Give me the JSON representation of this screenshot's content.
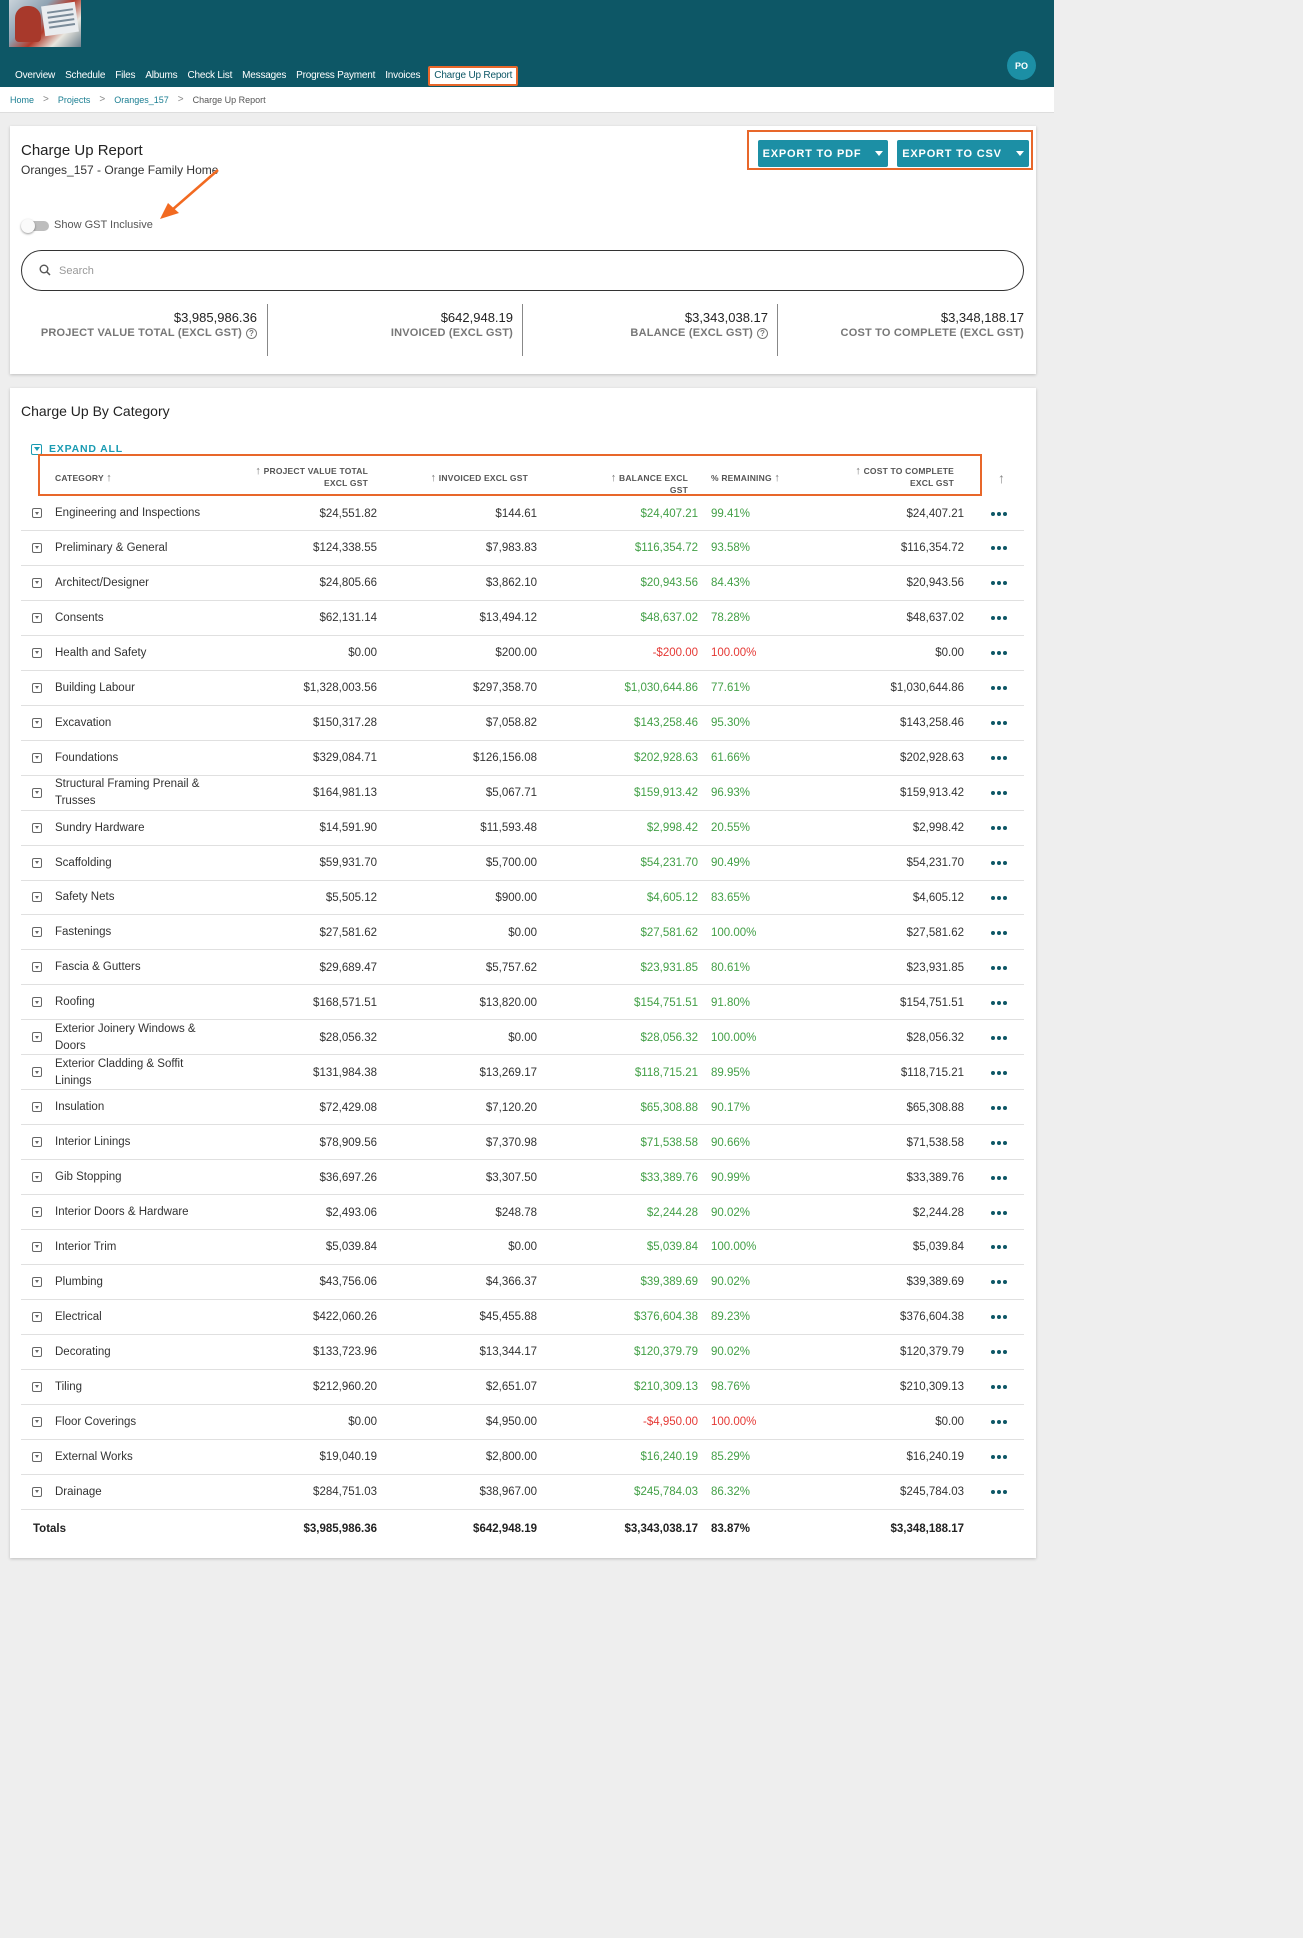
{
  "nav": {
    "items": [
      "Overview",
      "Schedule",
      "Files",
      "Albums",
      "Check List",
      "Messages",
      "Progress Payment",
      "Invoices",
      "Charge Up Report"
    ],
    "active": "Charge Up Report",
    "avatar_initials": "PO"
  },
  "breadcrumb": {
    "home": "Home",
    "projects": "Projects",
    "project": "Oranges_157",
    "current": "Charge Up Report",
    "separator": ">"
  },
  "report": {
    "title": "Charge Up Report",
    "subtitle": "Oranges_157 - Orange Family Home",
    "export_pdf": "EXPORT TO PDF",
    "export_csv": "EXPORT TO CSV",
    "gst_toggle_label": "Show GST Inclusive",
    "gst_toggle_on": false,
    "search_placeholder": "Search"
  },
  "stats": [
    {
      "value": "$3,985,986.36",
      "label": "PROJECT VALUE TOTAL (EXCL GST)",
      "help": true
    },
    {
      "value": "$642,948.19",
      "label": "INVOICED (EXCL GST)",
      "help": false
    },
    {
      "value": "$3,343,038.17",
      "label": "BALANCE (EXCL GST)",
      "help": true
    },
    {
      "value": "$3,348,188.17",
      "label": "COST TO COMPLETE (EXCL GST)",
      "help": false
    }
  ],
  "category_section": {
    "title": "Charge Up By Category",
    "expand_all": "EXPAND ALL",
    "columns": {
      "category": "CATEGORY",
      "project_value": "PROJECT VALUE TOTAL EXCL GST",
      "invoiced": "INVOICED EXCL GST",
      "balance": "BALANCE EXCL GST",
      "remaining": "% REMAINING",
      "cost_to_complete": "COST TO COMPLETE EXCL GST"
    },
    "rows": [
      {
        "category": "Engineering and Inspections",
        "project_value": "$24,551.82",
        "invoiced": "$144.61",
        "balance": "$24,407.21",
        "remaining": "99.41%",
        "cost_to_complete": "$24,407.21",
        "negative": false
      },
      {
        "category": "Preliminary & General",
        "project_value": "$124,338.55",
        "invoiced": "$7,983.83",
        "balance": "$116,354.72",
        "remaining": "93.58%",
        "cost_to_complete": "$116,354.72",
        "negative": false
      },
      {
        "category": "Architect/Designer",
        "project_value": "$24,805.66",
        "invoiced": "$3,862.10",
        "balance": "$20,943.56",
        "remaining": "84.43%",
        "cost_to_complete": "$20,943.56",
        "negative": false
      },
      {
        "category": "Consents",
        "project_value": "$62,131.14",
        "invoiced": "$13,494.12",
        "balance": "$48,637.02",
        "remaining": "78.28%",
        "cost_to_complete": "$48,637.02",
        "negative": false
      },
      {
        "category": "Health and Safety",
        "project_value": "$0.00",
        "invoiced": "$200.00",
        "balance": "-$200.00",
        "remaining": "100.00%",
        "cost_to_complete": "$0.00",
        "negative": true
      },
      {
        "category": "Building Labour",
        "project_value": "$1,328,003.56",
        "invoiced": "$297,358.70",
        "balance": "$1,030,644.86",
        "remaining": "77.61%",
        "cost_to_complete": "$1,030,644.86",
        "negative": false
      },
      {
        "category": "Excavation",
        "project_value": "$150,317.28",
        "invoiced": "$7,058.82",
        "balance": "$143,258.46",
        "remaining": "95.30%",
        "cost_to_complete": "$143,258.46",
        "negative": false
      },
      {
        "category": "Foundations",
        "project_value": "$329,084.71",
        "invoiced": "$126,156.08",
        "balance": "$202,928.63",
        "remaining": "61.66%",
        "cost_to_complete": "$202,928.63",
        "negative": false
      },
      {
        "category": "Structural Framing Prenail & Trusses",
        "project_value": "$164,981.13",
        "invoiced": "$5,067.71",
        "balance": "$159,913.42",
        "remaining": "96.93%",
        "cost_to_complete": "$159,913.42",
        "negative": false
      },
      {
        "category": "Sundry Hardware",
        "project_value": "$14,591.90",
        "invoiced": "$11,593.48",
        "balance": "$2,998.42",
        "remaining": "20.55%",
        "cost_to_complete": "$2,998.42",
        "negative": false
      },
      {
        "category": "Scaffolding",
        "project_value": "$59,931.70",
        "invoiced": "$5,700.00",
        "balance": "$54,231.70",
        "remaining": "90.49%",
        "cost_to_complete": "$54,231.70",
        "negative": false
      },
      {
        "category": "Safety Nets",
        "project_value": "$5,505.12",
        "invoiced": "$900.00",
        "balance": "$4,605.12",
        "remaining": "83.65%",
        "cost_to_complete": "$4,605.12",
        "negative": false
      },
      {
        "category": "Fastenings",
        "project_value": "$27,581.62",
        "invoiced": "$0.00",
        "balance": "$27,581.62",
        "remaining": "100.00%",
        "cost_to_complete": "$27,581.62",
        "negative": false
      },
      {
        "category": "Fascia & Gutters",
        "project_value": "$29,689.47",
        "invoiced": "$5,757.62",
        "balance": "$23,931.85",
        "remaining": "80.61%",
        "cost_to_complete": "$23,931.85",
        "negative": false
      },
      {
        "category": "Roofing",
        "project_value": "$168,571.51",
        "invoiced": "$13,820.00",
        "balance": "$154,751.51",
        "remaining": "91.80%",
        "cost_to_complete": "$154,751.51",
        "negative": false
      },
      {
        "category": "Exterior Joinery Windows & Doors",
        "project_value": "$28,056.32",
        "invoiced": "$0.00",
        "balance": "$28,056.32",
        "remaining": "100.00%",
        "cost_to_complete": "$28,056.32",
        "negative": false
      },
      {
        "category": "Exterior Cladding & Soffit Linings",
        "project_value": "$131,984.38",
        "invoiced": "$13,269.17",
        "balance": "$118,715.21",
        "remaining": "89.95%",
        "cost_to_complete": "$118,715.21",
        "negative": false
      },
      {
        "category": "Insulation",
        "project_value": "$72,429.08",
        "invoiced": "$7,120.20",
        "balance": "$65,308.88",
        "remaining": "90.17%",
        "cost_to_complete": "$65,308.88",
        "negative": false
      },
      {
        "category": "Interior Linings",
        "project_value": "$78,909.56",
        "invoiced": "$7,370.98",
        "balance": "$71,538.58",
        "remaining": "90.66%",
        "cost_to_complete": "$71,538.58",
        "negative": false
      },
      {
        "category": "Gib Stopping",
        "project_value": "$36,697.26",
        "invoiced": "$3,307.50",
        "balance": "$33,389.76",
        "remaining": "90.99%",
        "cost_to_complete": "$33,389.76",
        "negative": false
      },
      {
        "category": "Interior Doors & Hardware",
        "project_value": "$2,493.06",
        "invoiced": "$248.78",
        "balance": "$2,244.28",
        "remaining": "90.02%",
        "cost_to_complete": "$2,244.28",
        "negative": false
      },
      {
        "category": "Interior Trim",
        "project_value": "$5,039.84",
        "invoiced": "$0.00",
        "balance": "$5,039.84",
        "remaining": "100.00%",
        "cost_to_complete": "$5,039.84",
        "negative": false
      },
      {
        "category": "Plumbing",
        "project_value": "$43,756.06",
        "invoiced": "$4,366.37",
        "balance": "$39,389.69",
        "remaining": "90.02%",
        "cost_to_complete": "$39,389.69",
        "negative": false
      },
      {
        "category": "Electrical",
        "project_value": "$422,060.26",
        "invoiced": "$45,455.88",
        "balance": "$376,604.38",
        "remaining": "89.23%",
        "cost_to_complete": "$376,604.38",
        "negative": false
      },
      {
        "category": "Decorating",
        "project_value": "$133,723.96",
        "invoiced": "$13,344.17",
        "balance": "$120,379.79",
        "remaining": "90.02%",
        "cost_to_complete": "$120,379.79",
        "negative": false
      },
      {
        "category": "Tiling",
        "project_value": "$212,960.20",
        "invoiced": "$2,651.07",
        "balance": "$210,309.13",
        "remaining": "98.76%",
        "cost_to_complete": "$210,309.13",
        "negative": false
      },
      {
        "category": "Floor Coverings",
        "project_value": "$0.00",
        "invoiced": "$4,950.00",
        "balance": "-$4,950.00",
        "remaining": "100.00%",
        "cost_to_complete": "$0.00",
        "negative": true
      },
      {
        "category": "External Works",
        "project_value": "$19,040.19",
        "invoiced": "$2,800.00",
        "balance": "$16,240.19",
        "remaining": "85.29%",
        "cost_to_complete": "$16,240.19",
        "negative": false
      },
      {
        "category": "Drainage",
        "project_value": "$284,751.03",
        "invoiced": "$38,967.00",
        "balance": "$245,784.03",
        "remaining": "86.32%",
        "cost_to_complete": "$245,784.03",
        "negative": false
      }
    ],
    "totals": {
      "label": "Totals",
      "project_value": "$3,985,986.36",
      "invoiced": "$642,948.19",
      "balance": "$3,343,038.17",
      "remaining": "83.87%",
      "cost_to_complete": "$3,348,188.17"
    }
  },
  "colors": {
    "header_bg": "#0d5766",
    "accent": "#1c8fa5",
    "highlight": "#e8672a",
    "positive": "#43a047",
    "negative": "#e53935"
  },
  "icons": {
    "sort": "arrow-up-icon",
    "row_toggle": "expand-row-icon",
    "row_menu": "more-horizontal-icon",
    "search": "search-icon",
    "help": "help-circle-icon",
    "scroll_top": "arrow-up-icon",
    "annotation": "pointer-arrow-icon"
  }
}
